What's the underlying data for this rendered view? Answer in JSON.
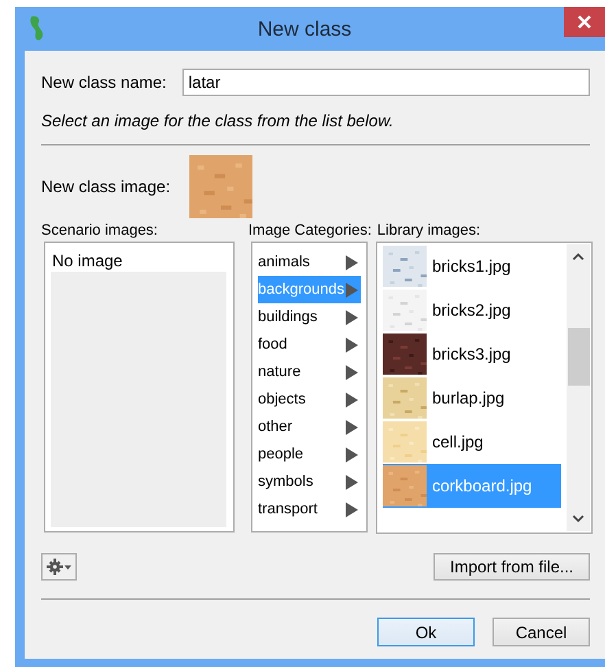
{
  "window": {
    "title": "New class"
  },
  "name_field": {
    "label": "New class name:",
    "value": "latar"
  },
  "instruction": "Select an image for the class from the list below.",
  "preview": {
    "label": "New class image:",
    "kind": "picture"
  },
  "scenario_images": {
    "label": "Scenario images:",
    "items": [
      "No image"
    ]
  },
  "categories": {
    "label": "Image Categories:",
    "items": [
      {
        "label": "animals",
        "selected": false
      },
      {
        "label": "backgrounds",
        "selected": true
      },
      {
        "label": "buildings",
        "selected": false
      },
      {
        "label": "food",
        "selected": false
      },
      {
        "label": "nature",
        "selected": false
      },
      {
        "label": "objects",
        "selected": false
      },
      {
        "label": "other",
        "selected": false
      },
      {
        "label": "people",
        "selected": false
      },
      {
        "label": "symbols",
        "selected": false
      },
      {
        "label": "transport",
        "selected": false
      }
    ]
  },
  "library": {
    "label": "Library images:",
    "items": [
      {
        "label": "bricks1.jpg",
        "selected": false
      },
      {
        "label": "bricks2.jpg",
        "selected": false
      },
      {
        "label": "bricks3.jpg",
        "selected": false
      },
      {
        "label": "burlap.jpg",
        "selected": false
      },
      {
        "label": "cell.jpg",
        "selected": false
      },
      {
        "label": "corkboard.jpg",
        "selected": true
      }
    ]
  },
  "import_button": "Import from file...",
  "buttons": [
    {
      "label": "Ok",
      "default": true
    },
    {
      "label": "Cancel",
      "default": false
    }
  ]
}
